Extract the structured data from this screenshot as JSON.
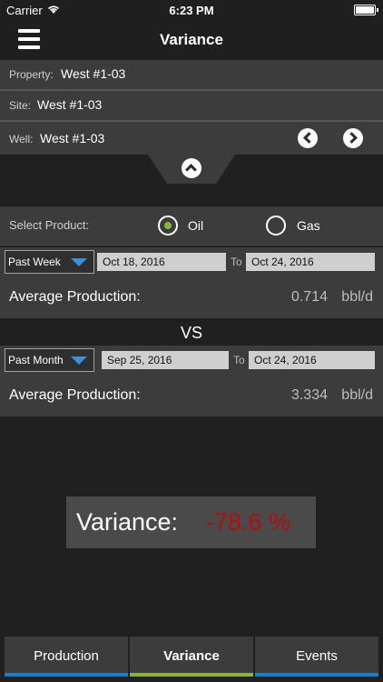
{
  "status_bar": {
    "carrier": "Carrier",
    "time": "6:23 PM"
  },
  "nav": {
    "title": "Variance",
    "menu_icon": "hamburger-menu-icon"
  },
  "info": {
    "property_label": "Property:",
    "property_value": "West #1-03",
    "site_label": "Site:",
    "site_value": "West #1-03",
    "well_label": "Well:",
    "well_value": "West #1-03"
  },
  "product": {
    "label": "Select Product:",
    "options": [
      "Oil",
      "Gas"
    ],
    "selected": "Oil"
  },
  "period1": {
    "range": "Past Week",
    "from": "Oct 18, 2016",
    "to_label": "To",
    "to": "Oct 24, 2016",
    "avg_label": "Average Production:",
    "avg_value": "0.714",
    "unit": "bbl/d"
  },
  "vs": "VS",
  "period2": {
    "range": "Past Month",
    "from": "Sep 25, 2016",
    "to_label": "To",
    "to": "Oct 24, 2016",
    "avg_label": "Average Production:",
    "avg_value": "3.334",
    "unit": "bbl/d"
  },
  "variance": {
    "label": "Variance:",
    "value": "-78.6 %",
    "value_color": "#b50d0d"
  },
  "tabs": [
    {
      "label": "Production"
    },
    {
      "label": "Variance",
      "active": true
    },
    {
      "label": "Events"
    }
  ],
  "colors": {
    "accent_active": "#8ab43a",
    "accent_tab": "#1a7fc7",
    "dropdown_arrow": "#3d8fdc"
  }
}
